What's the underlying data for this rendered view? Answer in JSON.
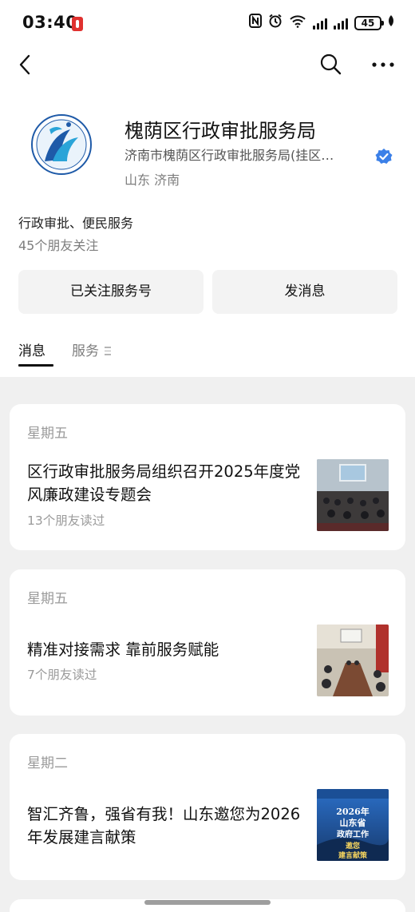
{
  "status_bar": {
    "time": "03:40",
    "battery": "45",
    "icons": [
      "notification-icon",
      "nfc-icon",
      "alarm-icon",
      "wifi-icon",
      "signal-icon",
      "signal-icon",
      "battery-icon",
      "leaf-icon"
    ]
  },
  "nav": {
    "icons": [
      "back-icon",
      "search-icon",
      "more-icon"
    ]
  },
  "profile": {
    "name": "槐荫区行政审批服务局",
    "organization": "济南市槐荫区行政审批服务局(挂区…",
    "region": "山东 济南",
    "description": "行政审批、便民服务",
    "followers": "45个朋友关注",
    "logo_text": "槐荫区行政审批服务局",
    "verified_color": "#3b80e8"
  },
  "buttons": {
    "follow": "已关注服务号",
    "message": "发消息"
  },
  "tabs": {
    "news": "消息",
    "service": "服务"
  },
  "articles": [
    {
      "day": "星期五",
      "title": "区行政审批服务局组织召开2025年度党风廉政建设专题会",
      "reads": "13个朋友读过"
    },
    {
      "day": "星期五",
      "title": "精准对接需求 靠前服务赋能",
      "reads": "7个朋友读过"
    },
    {
      "day": "星期二",
      "title": "智汇齐鲁，强省有我！山东邀您为2026年发展建言献策",
      "thumbnail_text": "2026年 山东省 政府工作 邀您 建言献策"
    }
  ],
  "colors": {
    "background": "#f0f0f0",
    "card": "#ffffff",
    "accent": "#3b80e8",
    "button": "#f3f3f3"
  }
}
